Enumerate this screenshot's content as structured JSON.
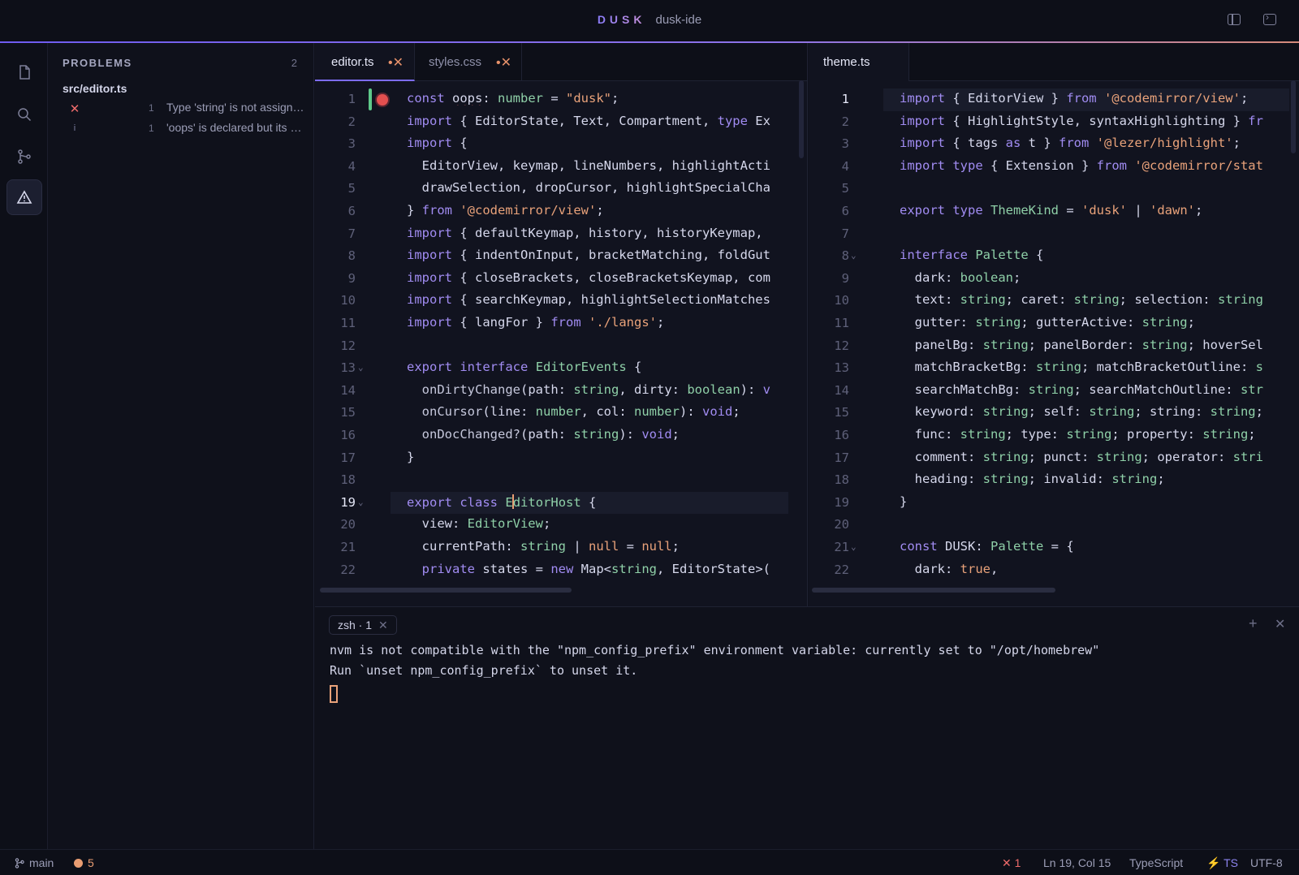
{
  "titlebar": {
    "brand": "DUSK",
    "workspace": "dusk-ide"
  },
  "sidebar": {
    "header": "PROBLEMS",
    "count": "2",
    "file": "src/editor.ts",
    "problems": [
      {
        "icon": "✕",
        "line": "1",
        "text": "Type 'string' is not assignable to type 'number'."
      },
      {
        "icon": "i",
        "line": "1",
        "text": "'oops' is declared but its value is never read."
      }
    ]
  },
  "left_group": {
    "tabs": [
      {
        "label": "editor.ts",
        "dirty": "•✕"
      },
      {
        "label": "styles.css",
        "dirty": "•✕"
      }
    ],
    "current_line": 19
  },
  "right_group": {
    "tabs": [
      {
        "label": "theme.ts"
      }
    ],
    "current_line": 1
  },
  "terminal": {
    "tab_label": "zsh · 1",
    "tab_close": "✕",
    "add": "+",
    "close": "✕",
    "lines": [
      "nvm is not compatible with the \"npm_config_prefix\" environment variable: currently set to \"/opt/homebrew\"",
      "Run `unset npm_config_prefix` to unset it."
    ]
  },
  "statusbar": {
    "branch": "main",
    "warnings": "5",
    "errors": "✕ 1",
    "position": "Ln 19, Col 15",
    "language": "TypeScript",
    "ts": "⚡ TS",
    "encoding": "UTF-8"
  },
  "colors": {
    "accent": "#7d6cf2",
    "keyword": "#a18cf2",
    "string": "#e9a27a",
    "type": "#8fd0a8",
    "error": "#ee6b6b"
  }
}
